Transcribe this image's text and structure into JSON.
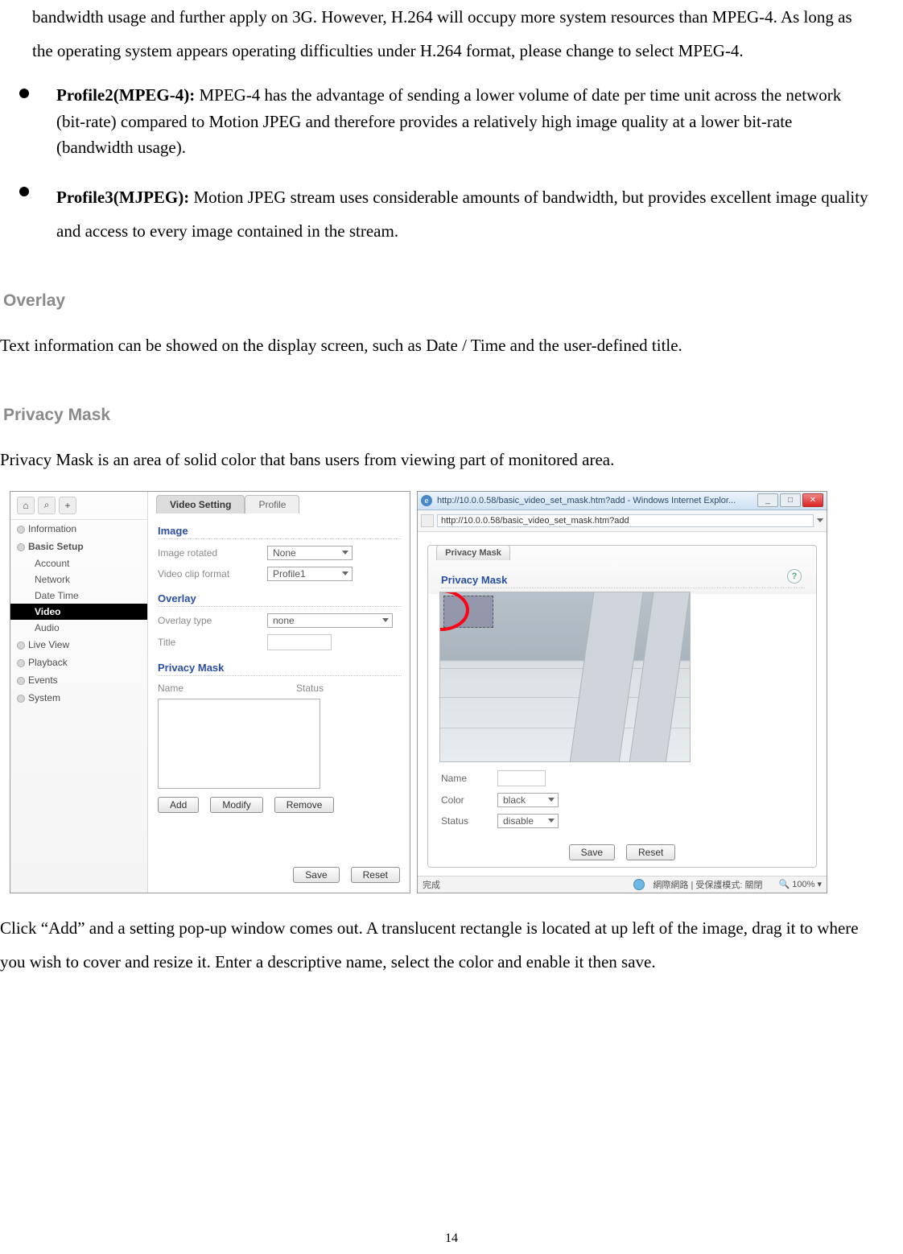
{
  "intro_paragraph": "bandwidth usage and further apply on 3G. However, H.264 will occupy more system resources than MPEG-4. As long as the operating system appears operating difficulties under H.264 format, please change to select MPEG-4.",
  "bullets": {
    "profile2": {
      "label": "Profile2(MPEG-4):",
      "text": " MPEG-4 has the advantage of sending a lower volume of date per time unit across the network (bit-rate) compared to Motion JPEG and therefore provides a relatively high image quality at a lower bit-rate (bandwidth usage)."
    },
    "profile3": {
      "label": "Profile3(MJPEG):",
      "text": " Motion JPEG stream uses considerable amounts of bandwidth, but provides excellent image quality and access to every image contained in the stream."
    }
  },
  "overlay": {
    "heading": "Overlay",
    "text": "Text information can be showed on the display screen, such as Date / Time and the user-defined title."
  },
  "privacy": {
    "heading": "Privacy Mask",
    "intro": "Privacy Mask is an area of solid color that bans users from viewing part of monitored area.",
    "outro": "Click “Add” and a setting pop-up window comes out. A translucent rectangle is located at up left of the image, drag it to where you wish to cover and resize it. Enter a descriptive name, select the color and enable it then save."
  },
  "panel_a": {
    "top_icons": {
      "home": "⌂",
      "find": "⌕",
      "plus": "+"
    },
    "nav": {
      "info": "Information",
      "basic": "Basic Setup",
      "account": "Account",
      "network": "Network",
      "datetime": "Date Time",
      "video": "Video",
      "audio": "Audio",
      "live": "Live View",
      "playback": "Playback",
      "events": "Events",
      "system": "System"
    },
    "tabs": {
      "video_setting": "Video Setting",
      "profile": "Profile"
    },
    "image": {
      "heading": "Image",
      "rotated_label": "Image rotated",
      "rotated_value": "None",
      "clip_label": "Video clip format",
      "clip_value": "Profile1"
    },
    "overlay": {
      "heading": "Overlay",
      "type_label": "Overlay type",
      "type_value": "none",
      "title_label": "Title",
      "title_value": ""
    },
    "mask": {
      "heading": "Privacy Mask",
      "col_name": "Name",
      "col_status": "Status",
      "btn_add": "Add",
      "btn_modify": "Modify",
      "btn_remove": "Remove"
    },
    "btn_save": "Save",
    "btn_reset": "Reset"
  },
  "panel_b": {
    "title": "http://10.0.0.58/basic_video_set_mask.htm?add - Windows Internet Explor...",
    "url": "http://10.0.0.58/basic_video_set_mask.htm?add",
    "tab_label": "Privacy Mask",
    "section_head": "Privacy Mask",
    "form": {
      "name_label": "Name",
      "name_value": "",
      "color_label": "Color",
      "color_value": "black",
      "status_label": "Status",
      "status_value": "disable"
    },
    "btn_save": "Save",
    "btn_reset": "Reset",
    "status_done": "完成",
    "status_net": "網際網路 | 受保護模式: 關閉",
    "status_zoom": "100%"
  },
  "page_number": "14"
}
